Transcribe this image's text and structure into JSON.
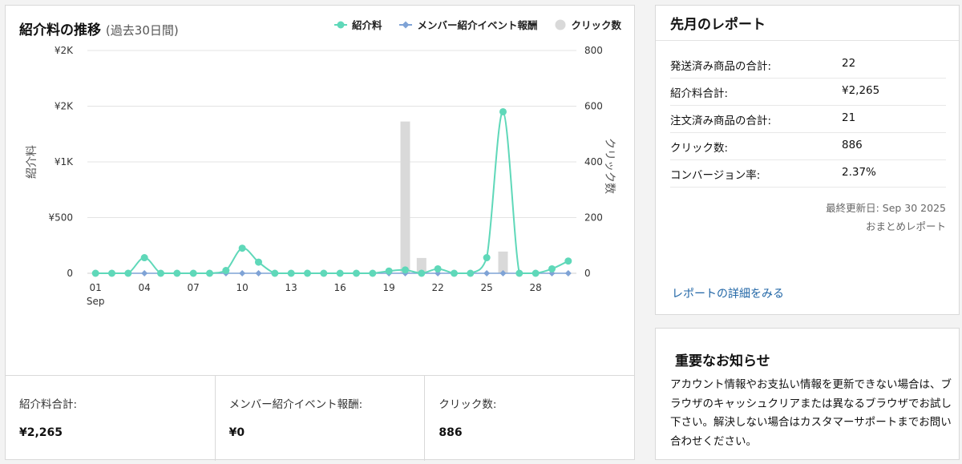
{
  "chart_panel": {
    "title": "紹介料の推移",
    "subtitle": "(過去30日間)",
    "legend": [
      {
        "label": "紹介料",
        "color": "#5fd8b9",
        "icon": "circle-marker"
      },
      {
        "label": "メンバー紹介イベント報酬",
        "color": "#7fa3d6",
        "icon": "diamond-marker"
      },
      {
        "label": "クリック数",
        "color": "#d9d9d9",
        "icon": "circle-marker"
      }
    ]
  },
  "chart_data": {
    "type": "line",
    "x_ticks": [
      "01",
      "04",
      "07",
      "10",
      "13",
      "16",
      "19",
      "22",
      "25",
      "28"
    ],
    "x_tick_month": "Sep",
    "ylabel": "紹介料",
    "y2label": "クリック数",
    "y_ticks": [
      "0",
      "¥500",
      "¥1K",
      "¥2K",
      "¥2K"
    ],
    "y2_ticks": [
      "0",
      "200",
      "400",
      "600",
      "800"
    ],
    "ylim": [
      0,
      2000
    ],
    "y2lim": [
      0,
      800
    ],
    "grid": true,
    "legend_position": "top-right",
    "days": [
      1,
      2,
      3,
      4,
      5,
      6,
      7,
      8,
      9,
      10,
      11,
      12,
      13,
      14,
      15,
      16,
      17,
      18,
      19,
      20,
      21,
      22,
      23,
      24,
      25,
      26,
      27,
      28,
      29,
      30
    ],
    "series": [
      {
        "name": "紹介料",
        "type": "line",
        "axis": "left",
        "color": "#5fd8b9",
        "values": [
          0,
          0,
          0,
          140,
          0,
          0,
          0,
          0,
          25,
          225,
          100,
          0,
          0,
          0,
          0,
          0,
          0,
          0,
          20,
          30,
          0,
          40,
          0,
          0,
          140,
          1450,
          0,
          0,
          40,
          110
        ]
      },
      {
        "name": "メンバー紹介イベント報酬",
        "type": "line",
        "axis": "left",
        "color": "#7fa3d6",
        "values": [
          0,
          0,
          0,
          0,
          0,
          0,
          0,
          0,
          0,
          0,
          0,
          0,
          0,
          0,
          0,
          0,
          0,
          0,
          0,
          0,
          0,
          0,
          0,
          0,
          0,
          0,
          0,
          0,
          0,
          0
        ]
      },
      {
        "name": "クリック数",
        "type": "bar",
        "axis": "right",
        "color": "#d9d9d9",
        "values": [
          0,
          0,
          0,
          0,
          0,
          0,
          0,
          0,
          0,
          0,
          0,
          0,
          0,
          0,
          0,
          0,
          0,
          0,
          0,
          545,
          55,
          0,
          0,
          0,
          0,
          78,
          0,
          0,
          0,
          0
        ]
      }
    ]
  },
  "summary": {
    "fee_label": "紹介料合計:",
    "fee_value": "¥2,265",
    "member_label": "メンバー紹介イベント報酬:",
    "member_value": "¥0",
    "clicks_label": "クリック数:",
    "clicks_value": "886"
  },
  "report": {
    "title": "先月のレポート",
    "rows": [
      {
        "label": "発送済み商品の合計:",
        "value": "22"
      },
      {
        "label": "紹介料合計:",
        "value": "¥2,265"
      },
      {
        "label": "注文済み商品の合計:",
        "value": "21"
      },
      {
        "label": "クリック数:",
        "value": "886"
      },
      {
        "label": "コンバージョン率:",
        "value": "2.37%"
      }
    ],
    "updated": "最終更新日: Sep 30 2025",
    "summary_note": "おまとめレポート",
    "link": "レポートの詳細をみる"
  },
  "notice": {
    "title": "重要なお知らせ",
    "body": "アカウント情報やお支払い情報を更新できない場合は、ブラウザのキャッシュクリアまたは異なるブラウザでお試し下さい。解決しない場合はカスタマーサポートまでお問い合わせください。"
  }
}
